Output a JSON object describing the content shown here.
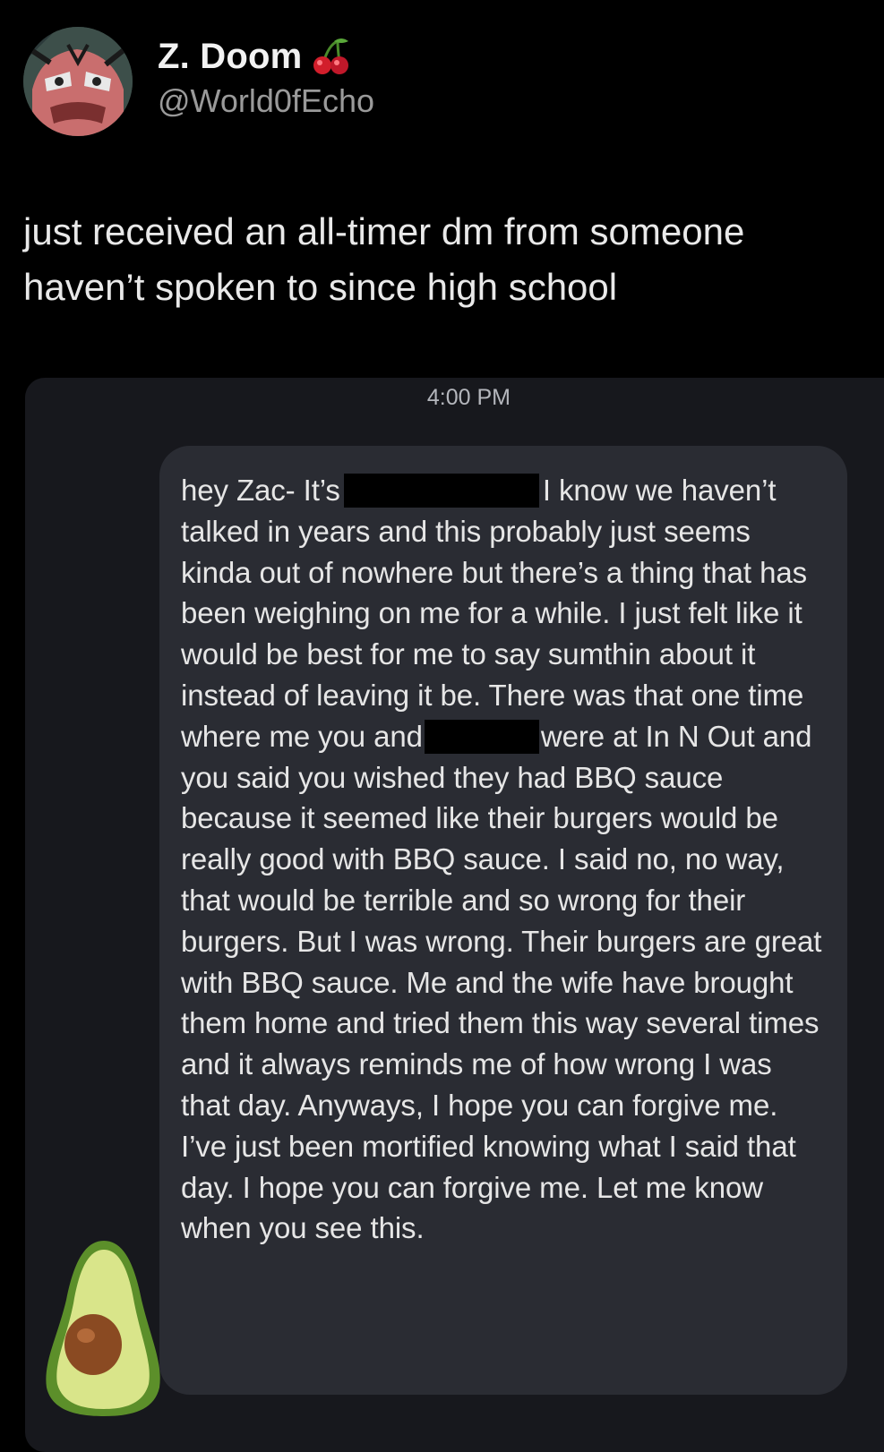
{
  "tweet": {
    "display_name": "Z. Doom",
    "handle": "@World0fEcho",
    "name_icon": "cherries-emoji",
    "avatar_icon": "comic-villain-face-avatar",
    "text": "just received an all-timer dm from someone haven’t spoken to since high school"
  },
  "dm": {
    "timestamp": "4:00 PM",
    "message_part1": "hey Zac- It’s",
    "message_part2": "I know we haven’t talked in years and this probably just seems kinda out of nowhere but there’s a thing that has been weighing on me for a while. I just felt like it would be best for me to say sumthin about it instead of leaving it be. There was that one time where me you and",
    "message_part3": "were at In N Out and you said you wished they had BBQ sauce because it seemed like their burgers would be really good with BBQ sauce. I said no, no way, that would be terrible and so wrong for their burgers. But I was wrong. Their burgers are great with BBQ sauce. Me and the wife have brought them home and tried them this way several times and it always reminds me of how wrong I was that day. Anyways, I hope you can forgive me. I’ve just been mortified knowing what I said that day. I hope you can forgive me. Let me know when you see this.",
    "sender_avatar_icon": "avocado-emoji"
  },
  "colors": {
    "background": "#000000",
    "card": "#17181d",
    "bubble": "#2a2c33",
    "handle": "#9a9a9a"
  }
}
